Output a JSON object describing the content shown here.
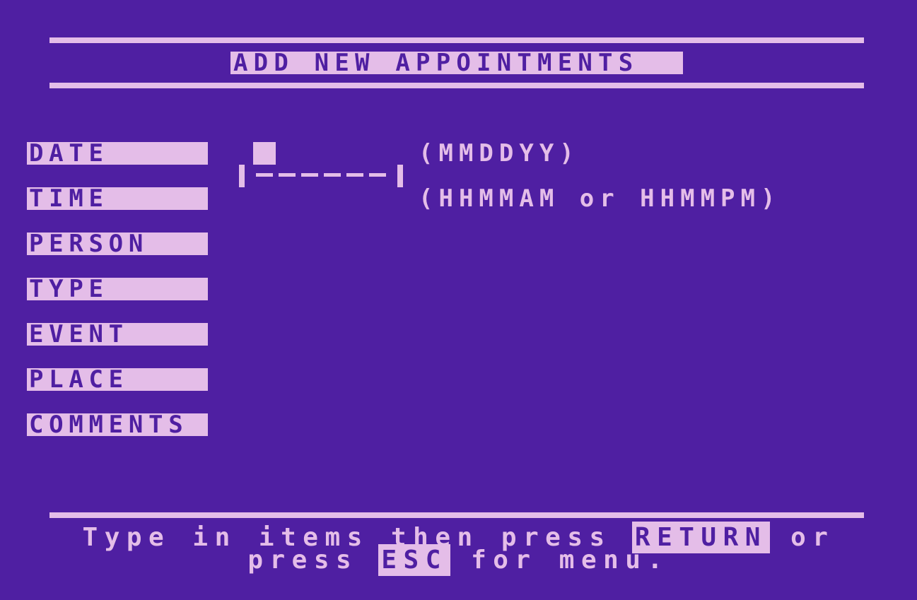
{
  "screen": {
    "title": "ADD NEW APPOINTMENTS",
    "colors": {
      "background": "#4f1fa2",
      "foreground": "#e4bde8"
    }
  },
  "fields": [
    {
      "label": "DATE",
      "hint": "(MMDDYY)",
      "value": ""
    },
    {
      "label": "TIME",
      "hint": "(HHMMAM or HHMMPM)",
      "value": ""
    },
    {
      "label": "PERSON",
      "hint": "",
      "value": ""
    },
    {
      "label": "TYPE",
      "hint": "",
      "value": ""
    },
    {
      "label": "EVENT",
      "hint": "",
      "value": ""
    },
    {
      "label": "PLACE",
      "hint": "",
      "value": ""
    },
    {
      "label": "COMMENTS",
      "hint": "",
      "value": ""
    }
  ],
  "active_field": {
    "name": "DATE",
    "max_length": 6,
    "placeholder": "------"
  },
  "footer": {
    "line1_prefix": "Type in items then press ",
    "return_key": "RETURN",
    "line1_suffix": " or",
    "line2_prefix": "press ",
    "esc_key": "ESC",
    "line2_suffix": " for menu."
  }
}
